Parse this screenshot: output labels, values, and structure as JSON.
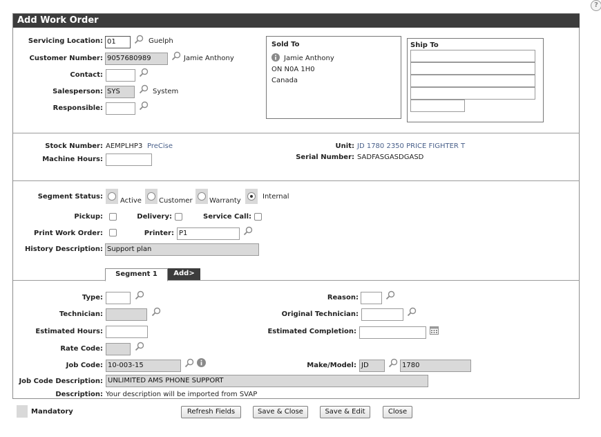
{
  "window": {
    "title": "Add Work Order",
    "help_icon": "?"
  },
  "header": {
    "servicing_location": {
      "label": "Servicing Location:",
      "value": "01",
      "name": "Guelph"
    },
    "customer_number": {
      "label": "Customer Number:",
      "value": "9057680989",
      "name": "Jamie Anthony"
    },
    "contact": {
      "label": "Contact:",
      "value": ""
    },
    "salesperson": {
      "label": "Salesperson:",
      "value": "SYS",
      "name": "System"
    },
    "responsible": {
      "label": "Responsible:",
      "value": ""
    }
  },
  "sold_to": {
    "title": "Sold To",
    "name": "Jamie Anthony",
    "line2": "ON N0A 1H0",
    "line3": "Canada"
  },
  "ship_to": {
    "title": "Ship To",
    "lines": [
      "",
      "",
      "",
      "",
      ""
    ]
  },
  "unit_info": {
    "stock_number": {
      "label": "Stock Number:",
      "value": "AEMPLHP3",
      "link": "PreCise"
    },
    "machine_hours": {
      "label": "Machine Hours:",
      "value": ""
    },
    "unit": {
      "label": "Unit:",
      "value": "JD 1780 2350 PRICE FIGHTER T"
    },
    "serial_number": {
      "label": "Serial Number:",
      "value": "SADFASGASDGASD"
    }
  },
  "segment": {
    "status_label": "Segment Status:",
    "status_options": [
      "Active",
      "Customer",
      "Warranty",
      "Internal"
    ],
    "status_selected": "Internal",
    "pickup_label": "Pickup:",
    "delivery_label": "Delivery:",
    "service_call_label": "Service Call:",
    "print_work_order_label": "Print Work Order:",
    "printer": {
      "label": "Printer:",
      "value": "P1"
    },
    "history_description": {
      "label": "History Description:",
      "value": "Support plan"
    }
  },
  "tabs": [
    {
      "label": "Segment 1",
      "active": true
    },
    {
      "label": "Add>",
      "active": false
    }
  ],
  "segment_detail": {
    "type": {
      "label": "Type:",
      "value": ""
    },
    "reason": {
      "label": "Reason:",
      "value": ""
    },
    "technician": {
      "label": "Technician:",
      "value": ""
    },
    "original_technician": {
      "label": "Original Technician:",
      "value": ""
    },
    "estimated_hours": {
      "label": "Estimated Hours:",
      "value": ""
    },
    "estimated_completion": {
      "label": "Estimated Completion:",
      "value": ""
    },
    "rate_code": {
      "label": "Rate Code:",
      "value": ""
    },
    "job_code": {
      "label": "Job Code:",
      "value": "10-003-15"
    },
    "make_model": {
      "label": "Make/Model:",
      "make": "JD",
      "model": "1780"
    },
    "job_code_description": {
      "label": "Job Code Description:",
      "value": "UNLIMITED AMS PHONE SUPPORT"
    },
    "description": {
      "label": "Description:",
      "value": "Your description will be imported from SVAP"
    }
  },
  "footer": {
    "mandatory_label": "Mandatory",
    "buttons": {
      "refresh": "Refresh Fields",
      "save_close": "Save & Close",
      "save_edit": "Save & Edit",
      "close": "Close"
    }
  },
  "colors": {
    "titlebar": "#3c3c3c",
    "mandatory": "#d9d9d9",
    "link": "#49608a"
  }
}
